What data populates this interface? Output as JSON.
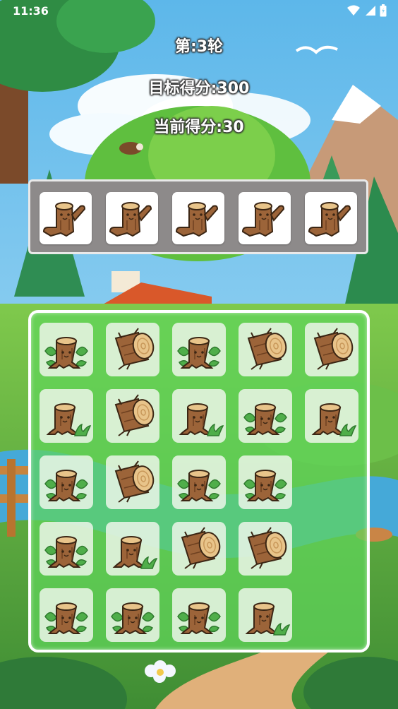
{
  "status_bar": {
    "time": "11:36"
  },
  "header": {
    "round_text": "第:3轮",
    "target_text": "目标得分:300",
    "current_text": "当前得分:30"
  },
  "tray": {
    "slots": [
      "waving-stump",
      "waving-stump",
      "waving-stump",
      "waving-stump",
      "waving-stump"
    ]
  },
  "board": {
    "rows": [
      [
        "leafy-stump",
        "log",
        "leafy-stump",
        "log",
        "log"
      ],
      [
        "grass-stump",
        "log",
        "grass-stump",
        "leafy-stump",
        "grass-stump"
      ],
      [
        "leafy-stump",
        "log",
        "leafy-stump",
        "leafy-stump"
      ],
      [
        "leafy-stump",
        "grass-stump",
        "log",
        "log"
      ],
      [
        "leafy-stump",
        "leafy-stump",
        "leafy-stump",
        "grass-stump"
      ]
    ]
  },
  "colors": {
    "tray_bg": "#8d8a8a",
    "board_bg": "#60d55a",
    "wood": "#9c6439",
    "leaf": "#4fae4a"
  }
}
